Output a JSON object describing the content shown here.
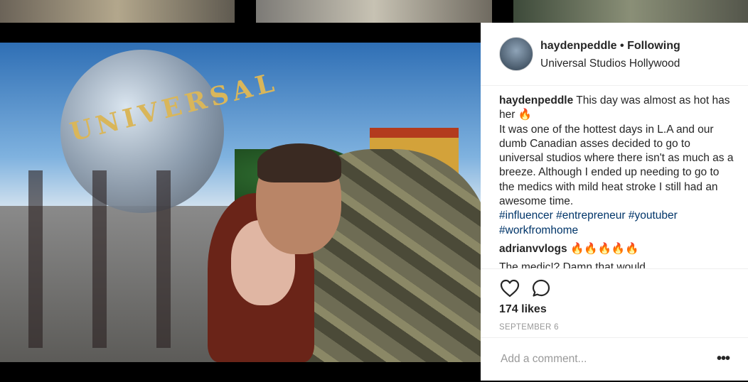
{
  "post": {
    "username": "haydenpeddle",
    "separator": "•",
    "follow_status": "Following",
    "location": "Universal Studios Hollywood",
    "photo_sign_text": "UNIVERSAL"
  },
  "caption": {
    "username": "haydenpeddle",
    "line1": "This day was almost as hot has her",
    "emoji": "🔥",
    "body": "It was one of the hottest days in L.A and our dumb Canadian asses decided to go to universal studios where there isn't as much as a breeze. Although I ended up needing to go to the medics with mild heat stroke I still had an awesome time.",
    "hashtags": [
      "#influencer",
      "#entrepreneur",
      "#youtuber",
      "#workfromhome"
    ]
  },
  "comment2": {
    "username": "adrianvvlogs",
    "text": "🔥🔥🔥🔥🔥"
  },
  "comment3_partial": {
    "text": "The medic!? Damn that would"
  },
  "actions": {
    "like_icon": "heart-icon",
    "comment_icon": "comment-icon"
  },
  "likes": "174 likes",
  "date": "SEPTEMBER 6",
  "add_comment": {
    "placeholder": "Add a comment...",
    "more": "•••"
  },
  "colors": {
    "hashtag": "#003569",
    "text": "#262626",
    "muted": "#999999"
  }
}
